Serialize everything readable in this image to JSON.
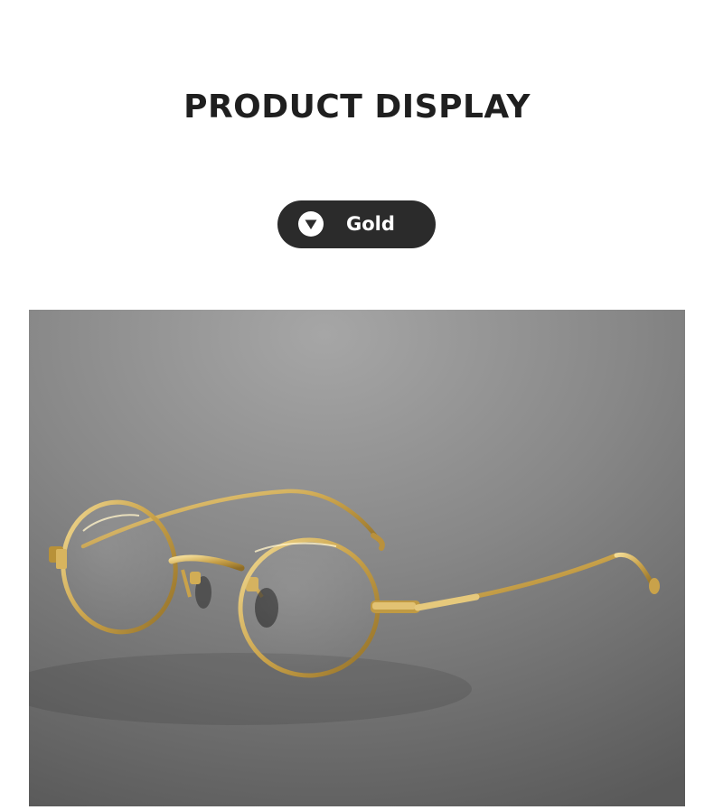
{
  "header": {
    "title": "PRODUCT DISPLAY"
  },
  "color_selector": {
    "label": "Gold",
    "icon": "chevron-down-icon",
    "background": "#2b2b2b"
  },
  "product_image": {
    "subject": "eyeglasses-icon",
    "frame_color": "#c9a24a",
    "backdrop_color": "#7a7a7a"
  }
}
